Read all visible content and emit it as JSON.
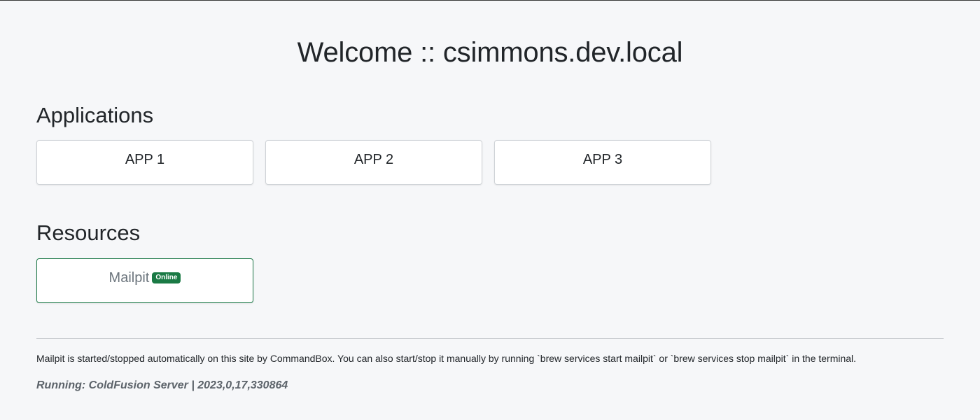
{
  "header": {
    "title": "Welcome :: csimmons.dev.local"
  },
  "applications": {
    "heading": "Applications",
    "items": [
      {
        "label": "APP 1"
      },
      {
        "label": "APP 2"
      },
      {
        "label": "APP 3"
      }
    ]
  },
  "resources": {
    "heading": "Resources",
    "items": [
      {
        "label": "Mailpit",
        "status": "Online",
        "status_color": "#1a7a45"
      }
    ]
  },
  "footer": {
    "note": "Mailpit is started/stopped automatically on this site by CommandBox. You can also start/stop it manually by running `brew services start mailpit` or `brew services stop mailpit` in the terminal.",
    "running": "Running: ColdFusion Server | 2023,0,17,330864"
  }
}
